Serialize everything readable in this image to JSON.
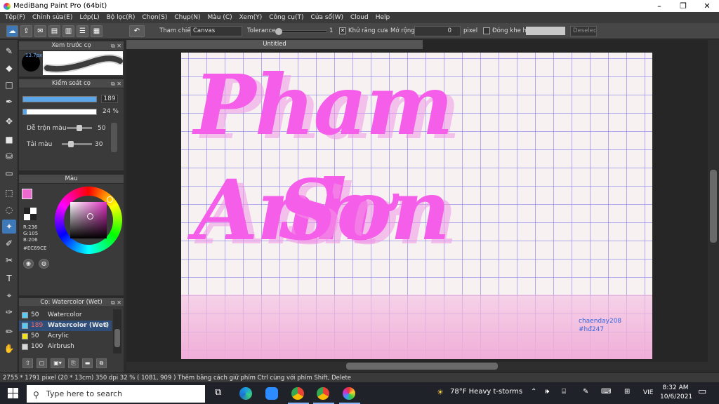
{
  "window": {
    "title": "MediBang Paint Pro (64bit)",
    "minimize": "–",
    "maximize": "❐",
    "close": "✕"
  },
  "menu": [
    "Tệp(F)",
    "Chỉnh sửa(E)",
    "Lớp(L)",
    "Bộ lọc(R)",
    "Chọn(S)",
    "Chụp(N)",
    "Màu (C)",
    "Xem(Y)",
    "Công cụ(T)",
    "Cửa sổ(W)",
    "Cloud",
    "Help"
  ],
  "toolbar": {
    "reference_label": "Tham chiếu",
    "reference_value": "Canvas",
    "tolerance_label": "Tolerance",
    "tolerance_value": "1",
    "antialias_label": "Khử răng cưa",
    "antialias_check": "✕",
    "expand_label": "Mở rộng",
    "expand_value": "0",
    "pixel_label": "pixel",
    "close_gap_label": "Đóng khe hở",
    "deselect_label": "Deselec"
  },
  "brush_preview": {
    "title": "Xem trước cọ",
    "size_label": "13.7px"
  },
  "brush_control": {
    "title": "Kiểm soát cọ",
    "size_value": "189",
    "size_fill": 1.0,
    "opacity_value": "24 %",
    "opacity_fill": 0.05,
    "mix_label": "Dễ trộn màu",
    "mix_value": "50",
    "mix_fill": 0.5,
    "reload_label": "Tải màu",
    "reload_value": "30",
    "reload_fill": 0.3
  },
  "color_panel": {
    "title": "Màu",
    "r": "R:236",
    "g": "G:105",
    "b": "B:206",
    "hex": "#EC69CE",
    "color": "#EC69CE"
  },
  "brush_list": {
    "title": "Cọ: Watercolor (Wet)",
    "items": [
      {
        "size": "50",
        "name": "Watercolor",
        "swatch": "#5ac8f0"
      },
      {
        "size": "189",
        "name": "Watercolor (Wet)",
        "swatch": "#5ac8f0"
      },
      {
        "size": "50",
        "name": "Acrylic",
        "swatch": "#f0e020"
      },
      {
        "size": "100",
        "name": "Airbrush",
        "swatch": "#d8d8d8"
      }
    ]
  },
  "document": {
    "tab": "Untitled"
  },
  "canvas": {
    "line1": "Pham Anh",
    "line2": "Sơn",
    "signature1": "chaenday208",
    "signature2": "#hđ247"
  },
  "status": {
    "text": "2755 * 1791 pixel   (20 * 13cm)   350 dpi   32 %   ( 1081, 909 )   Thêm bằng cách giữ phím Ctrl cùng với phím Shift, Delete"
  },
  "taskbar": {
    "search_placeholder": "Type here to search",
    "weather": "78°F  Heavy t-storms",
    "lang": "VIE",
    "time": "8:32 AM",
    "date": "10/6/2021"
  }
}
